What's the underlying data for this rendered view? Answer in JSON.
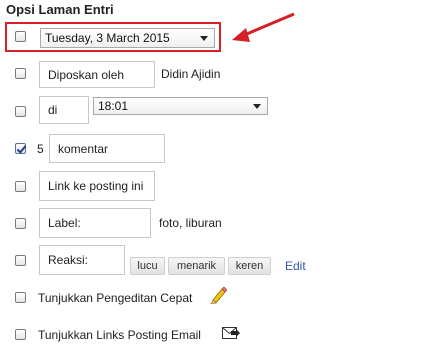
{
  "title": "Opsi Laman Entri",
  "rows": {
    "date": {
      "value": "Tuesday, 3 March 2015"
    },
    "author": {
      "label": "Diposkan oleh",
      "value": "Didin Ajidin"
    },
    "time": {
      "label": "di",
      "value": "18:01"
    },
    "comments": {
      "count": "5",
      "label": "komentar",
      "checked": true
    },
    "link": {
      "label": "Link ke posting ini"
    },
    "labels": {
      "label": "Label:",
      "value": "foto, liburan"
    },
    "reactions": {
      "label": "Reaksi:",
      "chips": [
        "lucu",
        "menarik",
        "keren"
      ],
      "edit": "Edit"
    },
    "quick_edit": {
      "label": "Tunjukkan Pengeditan Cepat"
    },
    "email_links": {
      "label": "Tunjukkan Links Posting Email"
    }
  },
  "colors": {
    "highlight": "#d61f26",
    "link": "#2f57a7"
  }
}
